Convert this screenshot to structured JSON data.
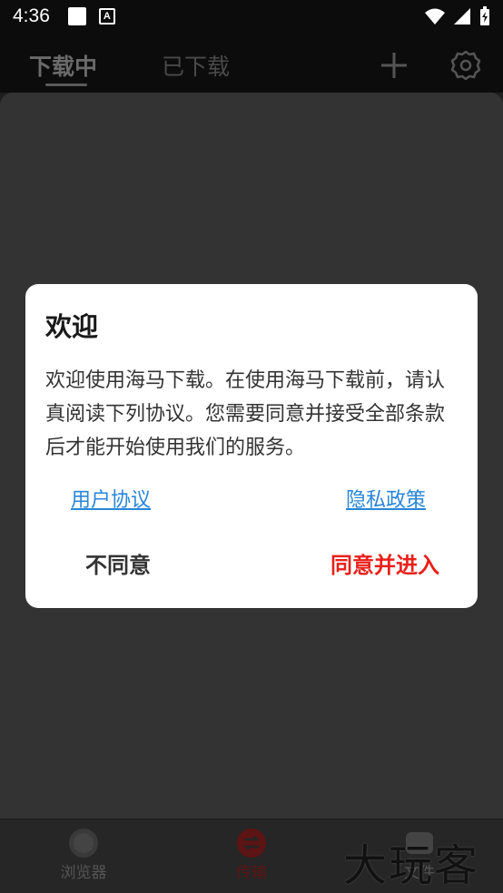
{
  "status_bar": {
    "time": "4:36",
    "notif_letter": "A"
  },
  "app_bar": {
    "tabs": [
      {
        "label": "下载中",
        "active": true
      },
      {
        "label": "已下载",
        "active": false
      }
    ]
  },
  "dialog": {
    "title": "欢迎",
    "body": "欢迎使用海马下载。在使用海马下载前，请认真阅读下列协议。您需要同意并接受全部条款后才能开始使用我们的服务。",
    "links": {
      "user_agreement": "用户协议",
      "privacy_policy": "隐私政策"
    },
    "buttons": {
      "disagree": "不同意",
      "agree": "同意并进入"
    },
    "colors": {
      "link": "#2a86d8",
      "agree": "#e8201a"
    }
  },
  "bottom_nav": {
    "items": [
      {
        "label": "浏览器",
        "icon": "browser-icon"
      },
      {
        "label": "传输",
        "icon": "transfer-icon",
        "active": true
      },
      {
        "label": "文件",
        "icon": "folder-icon"
      }
    ]
  },
  "watermark": "大玩客"
}
